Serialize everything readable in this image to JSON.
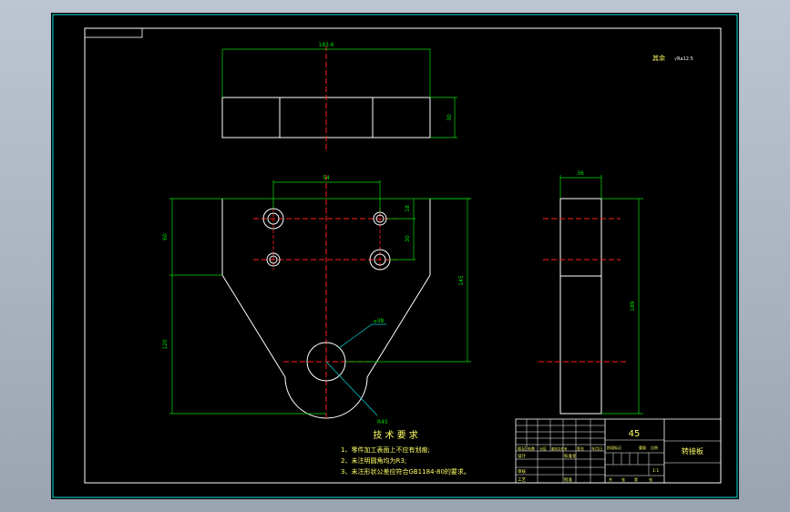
{
  "dimensions": {
    "top_length": "183.6",
    "top_height": "30",
    "hole_spacing": "54",
    "hole_offset_top": "18",
    "hole_spacing_vertical": "30",
    "upper_height": "60",
    "lower_height": "120",
    "center_height": "145",
    "bore_diameter": "⌀38",
    "arc_radius": "R45",
    "side_width": "36",
    "side_height": "189"
  },
  "surface_note": {
    "label": "其余",
    "symbol": "√Ra12.5"
  },
  "tech_requirements": {
    "title": "技 术 要 求",
    "items": [
      "1、零件加工表面上不应有划痕;",
      "2、未注明圆角均为R3;",
      "3、未注形状公差应符合GB1184-80的要求。"
    ]
  },
  "title_block": {
    "material": "45",
    "part_name": "转接板",
    "scale": "1:1",
    "row_labels": [
      "标记",
      "设计",
      "审核",
      "工艺"
    ],
    "col_labels": [
      "处数",
      "分区",
      "更改文件号",
      "签名",
      "年月日"
    ],
    "mid_labels": [
      "标准化",
      "批准"
    ],
    "stage_labels": [
      "阶段标记",
      "重量",
      "比例"
    ],
    "sheet_labels": [
      "共",
      "张",
      "第",
      "张"
    ]
  }
}
